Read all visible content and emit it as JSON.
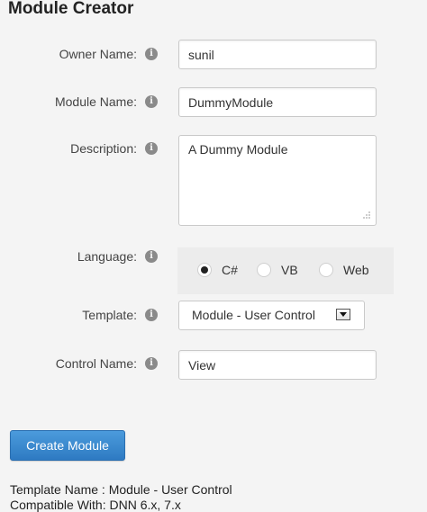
{
  "title": "Module Creator",
  "fields": {
    "owner": {
      "label": "Owner Name:",
      "value": "sunil"
    },
    "module": {
      "label": "Module Name:",
      "value": "DummyModule"
    },
    "description": {
      "label": "Description:",
      "value": "A Dummy Module"
    },
    "language": {
      "label": "Language:",
      "options": [
        "C#",
        "VB",
        "Web"
      ],
      "selected": "C#"
    },
    "template": {
      "label": "Template:",
      "value": "Module - User Control"
    },
    "control": {
      "label": "Control Name:",
      "value": "View"
    }
  },
  "create_button": "Create Module",
  "footer": {
    "template_name": "Template Name : Module - User Control",
    "compatible": "Compatible With: DNN 6.x, 7.x"
  },
  "colors": {
    "background": "#f4f4f4",
    "button": "#3b87cf",
    "info_icon": "#8a8a8a"
  }
}
